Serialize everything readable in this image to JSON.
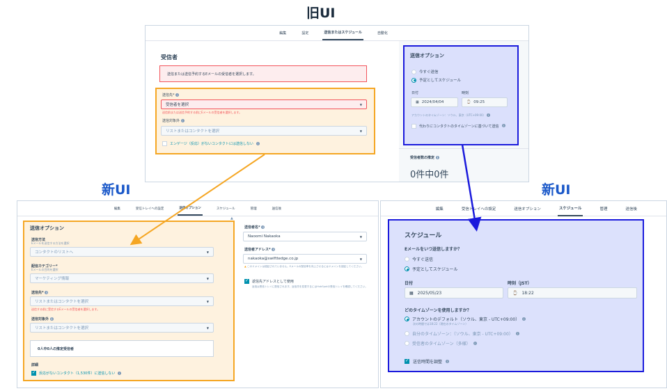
{
  "labels": {
    "old_ui": "旧UI",
    "new_ui_left": "新UI",
    "new_ui_right": "新UI"
  },
  "old": {
    "tabs": [
      "編集",
      "設定",
      "送信またはスケジュール",
      "自動化"
    ],
    "active_tab": 2,
    "recipients": {
      "title": "受信者",
      "notice": "送信または送信予約するEメールの受信者を選択します。",
      "send_to_label": "送信先*",
      "send_to_value": "受信者を選択",
      "send_to_error": "送信前または送信予約する前にEメールの受信者を選択します。",
      "exclude_label": "送信対象外",
      "exclude_value": "リストまたはコンタクトを選択",
      "engage_checkbox": "エンゲージ（反応）がないコンタクトには送信しない"
    },
    "send_options": {
      "title": "送信オプション",
      "radio_now": "今すぐ送信",
      "radio_schedule": "予定としてスケジュール",
      "date_label": "日付",
      "date_value": "2024/04/04",
      "time_label": "時刻",
      "time_value": "09:25",
      "tz_text": "アカウントのタイムゾーン：ソウル、東京（UTC+09:00）",
      "contact_tz_checkbox": "代わりにコンタクトのタイムゾーンに基づいて送信"
    },
    "estimate": {
      "title": "受信者数の推定",
      "value": "0件中0件"
    }
  },
  "new_left": {
    "tabs": [
      "編集",
      "受信トレイへの設定",
      "送信オプション",
      "スケジュール",
      "管理",
      "送信後"
    ],
    "active_tab": 2,
    "title": "送信オプション",
    "method_label": "送信方法",
    "method_sub": "Eメールを送信する方法を選択",
    "method_value": "コンタクトのリストへ",
    "category_label": "配信カテゴリー*",
    "category_sub": "Eメールの目的を選択",
    "category_value": "マーケティング情報",
    "send_to_label": "送信先*",
    "send_to_value": "リストまたはコンタクトを選択",
    "send_to_error": "送信する前に受信するEメールの受信者を選択します。",
    "exclude_label": "送信対象外",
    "exclude_value": "リストまたはコンタクトを選択",
    "estimate": "0人中0人の推定受信者",
    "detail_label": "詳細",
    "detail_checkbox": "反応がないコンタクト（1,530件）に送信しない",
    "sender_name_label": "送信者名*",
    "sender_name_value": "Naoomi Nakaoka",
    "sender_addr_label": "送信者アドレス*",
    "sender_addr_value": "nakaoka@swifttedge.co.jp",
    "sender_addr_warn": "このドメインは認証されていません。Eメールの配信率を向上させるにはドメインを認証してください。",
    "reply_checkbox": "返信先アドレスとして使用",
    "reply_desc": "返信は受信トレイに配信されます。返信先を変更するにはHubSpotの受信トレイを確認してください。"
  },
  "new_right": {
    "tabs": [
      "編集",
      "受信トレイへの設定",
      "送信オプション",
      "スケジュール",
      "管理",
      "送信後"
    ],
    "active_tab": 3,
    "title": "スケジュール",
    "when_label": "Eメールをいつ送信しますか？",
    "radio_now": "今すぐ送信",
    "radio_schedule": "予定としてスケジュール",
    "date_label": "日付",
    "date_value": "2025/05/23",
    "time_label": "時刻（JST）",
    "time_value": "18:22",
    "tz_question": "どのタイムゾーンを使用しますか？",
    "tz_account": "アカウントのデフォルト（ソウル、東京 - UTC+09:00）",
    "tz_account_sub": "次の時間では18:22（現在のタイムゾーン）",
    "tz_own": "自分のタイムゾーン：（ソウル、東京 - UTC+09:00）",
    "tz_recipient": "受信者のタイムゾーン（多様）",
    "optimize_checkbox": "送信時間を調整"
  }
}
